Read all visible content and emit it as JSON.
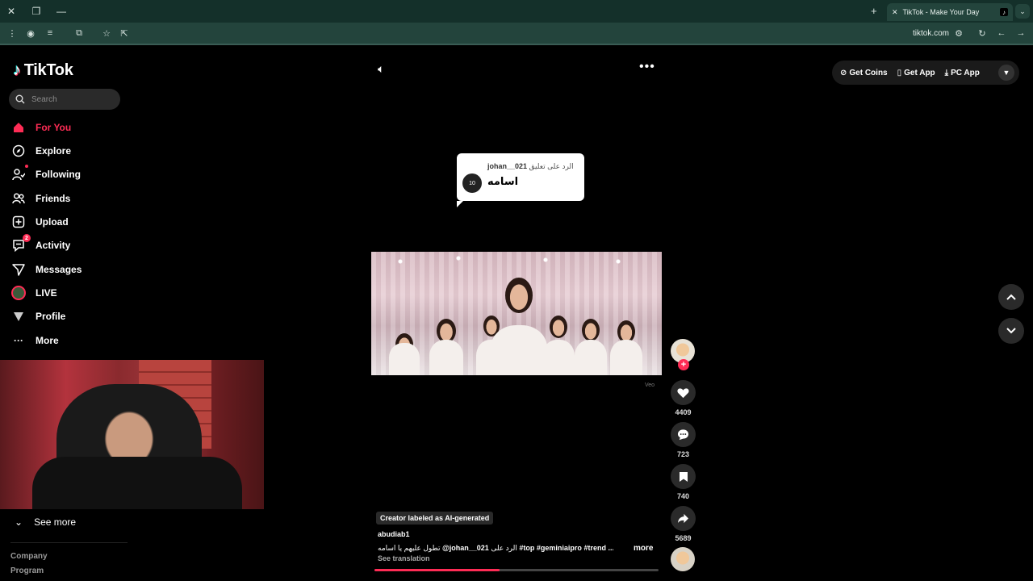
{
  "browser": {
    "tab_title": "TikTok - Make Your Day",
    "tab_favicon": "tiktok-icon",
    "url": "tiktok.com"
  },
  "sidebar": {
    "logo": "TikTok",
    "search_placeholder": "Search",
    "items": [
      {
        "label": "For You",
        "icon": "home-icon"
      },
      {
        "label": "Explore",
        "icon": "compass-icon"
      },
      {
        "label": "Following",
        "icon": "following-icon"
      },
      {
        "label": "Friends",
        "icon": "friends-icon"
      },
      {
        "label": "Upload",
        "icon": "upload-icon"
      },
      {
        "label": "Activity",
        "icon": "activity-icon",
        "badge": "2"
      },
      {
        "label": "Messages",
        "icon": "messages-icon"
      },
      {
        "label": "LIVE",
        "icon": "live-avatar"
      },
      {
        "label": "Profile",
        "icon": "profile-icon"
      },
      {
        "label": "More",
        "icon": "more-icon"
      }
    ],
    "see_more": "See more",
    "footer": [
      "Company",
      "Program"
    ]
  },
  "header": {
    "get_coins": "Get Coins",
    "get_app": "Get App",
    "pc_app": "PC App"
  },
  "reply_bubble": {
    "reply_prefix": "الرد على تعليق",
    "reply_user": "johan__021",
    "comment": "اسامه",
    "avatar_text": "10"
  },
  "video": {
    "watermark": "Veo",
    "ai_label": "Creator labeled as AI-generated",
    "username": "abudiab1",
    "caption_prefix": "الرد على",
    "caption_mention": "@johan__021",
    "caption_text": "تطول عليهم يا اسامه",
    "hashtags": [
      "#top",
      "#geminiaipro",
      "#trend"
    ],
    "ellipsis": "...",
    "more": "more",
    "see_translation": "See translation",
    "progress": 0.44
  },
  "actions": {
    "likes": "4409",
    "comments": "723",
    "saves": "740",
    "shares": "5689"
  },
  "colors": {
    "accent": "#fe2c55",
    "chrome": "#23443c"
  }
}
